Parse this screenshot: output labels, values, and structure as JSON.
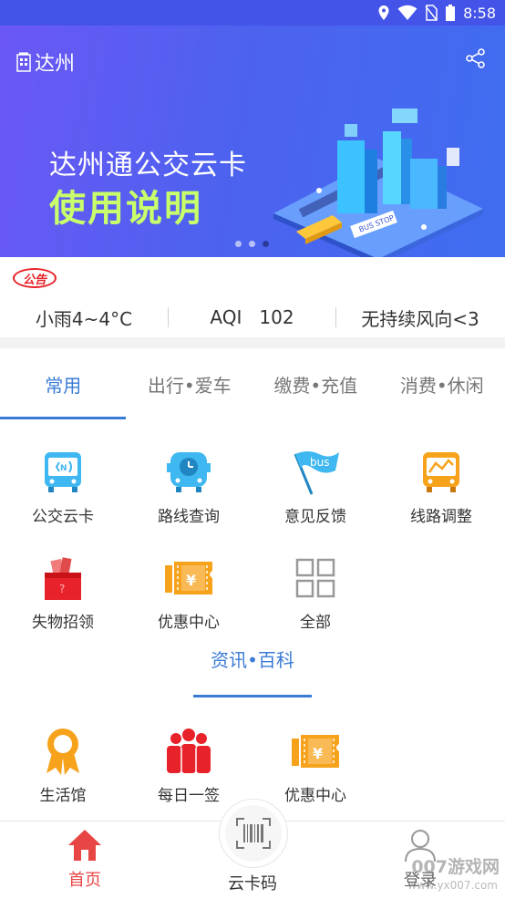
{
  "status_bar": {
    "time": "8:58"
  },
  "banner": {
    "city": "达州",
    "title_line1": "达州通公交云卡",
    "title_line2": "使用说明",
    "art_sign": "BUS STOP",
    "page_count": 3,
    "active_page": 3
  },
  "notice": {
    "badge": "公告"
  },
  "weather": {
    "condition": "小雨4~4°C",
    "aqi": "AQI   102",
    "wind": "无持续风向<3"
  },
  "tabs": [
    {
      "label": "常用",
      "active": true
    },
    {
      "label": "出行•爱车",
      "active": false
    },
    {
      "label": "缴费•充值",
      "active": false
    },
    {
      "label": "消费•休闲",
      "active": false
    }
  ],
  "services": [
    {
      "label": "公交云卡",
      "icon": "bus-card-icon"
    },
    {
      "label": "路线查询",
      "icon": "bus-schedule-icon"
    },
    {
      "label": "意见反馈",
      "icon": "bus-flag-icon"
    },
    {
      "label": "线路调整",
      "icon": "route-adjust-icon"
    },
    {
      "label": "失物招领",
      "icon": "lost-found-bag-icon"
    },
    {
      "label": "优惠中心",
      "icon": "coupon-icon"
    },
    {
      "label": "全部",
      "icon": "grid-all-icon"
    }
  ],
  "section": {
    "title": "资讯•百科"
  },
  "info_items": [
    {
      "label": "生活馆",
      "icon": "award-ribbon-icon"
    },
    {
      "label": "每日一签",
      "icon": "people-group-icon"
    },
    {
      "label": "优惠中心",
      "icon": "coupon-icon"
    }
  ],
  "bottom_nav": {
    "home": "首页",
    "card_code": "云卡码",
    "profile": "登录"
  },
  "watermark": {
    "line1": "007游戏网",
    "line2": "www.yx007.com"
  },
  "colors": {
    "primary": "#3a7bd5",
    "banner_start": "#6b57f5",
    "banner_end": "#3f6df0",
    "accent_red": "#e8222a",
    "highlight_green": "#c8ff6a"
  }
}
